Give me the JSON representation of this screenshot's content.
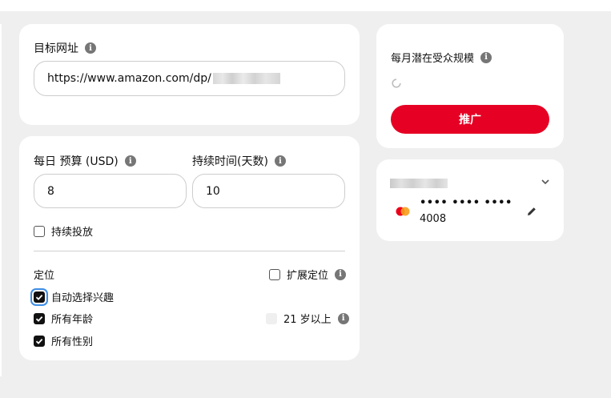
{
  "url_section": {
    "label": "目标网址",
    "url_value": "https://www.amazon.com/dp/"
  },
  "budget_section": {
    "daily_budget_label": "每日 预算 (USD)",
    "daily_budget_value": "8",
    "duration_label": "持续时间(天数)",
    "duration_value": "10",
    "continuous_label": "持续投放",
    "continuous_checked": false
  },
  "targeting": {
    "title": "定位",
    "expand_label": "扩展定位",
    "expand_checked": false,
    "options": [
      {
        "label": "自动选择兴趣",
        "checked": true
      },
      {
        "label": "所有年龄",
        "checked": true
      },
      {
        "label": "所有性别",
        "checked": true
      }
    ],
    "age_21_label": "21 岁以上",
    "age_21_checked": false
  },
  "audience_card": {
    "label": "每月潜在受众规模",
    "promote_button": "推广"
  },
  "payment_card": {
    "card_mask": "•••• •••• ••••",
    "card_last4": "4008"
  },
  "colors": {
    "brand_red": "#e60023",
    "mastercard_red": "#eb001b",
    "mastercard_orange": "#f79e1b"
  },
  "icons": [
    "info-icon",
    "spinner-icon",
    "chevron-down-icon",
    "pencil-icon",
    "mastercard-icon",
    "checkmark-icon"
  ]
}
